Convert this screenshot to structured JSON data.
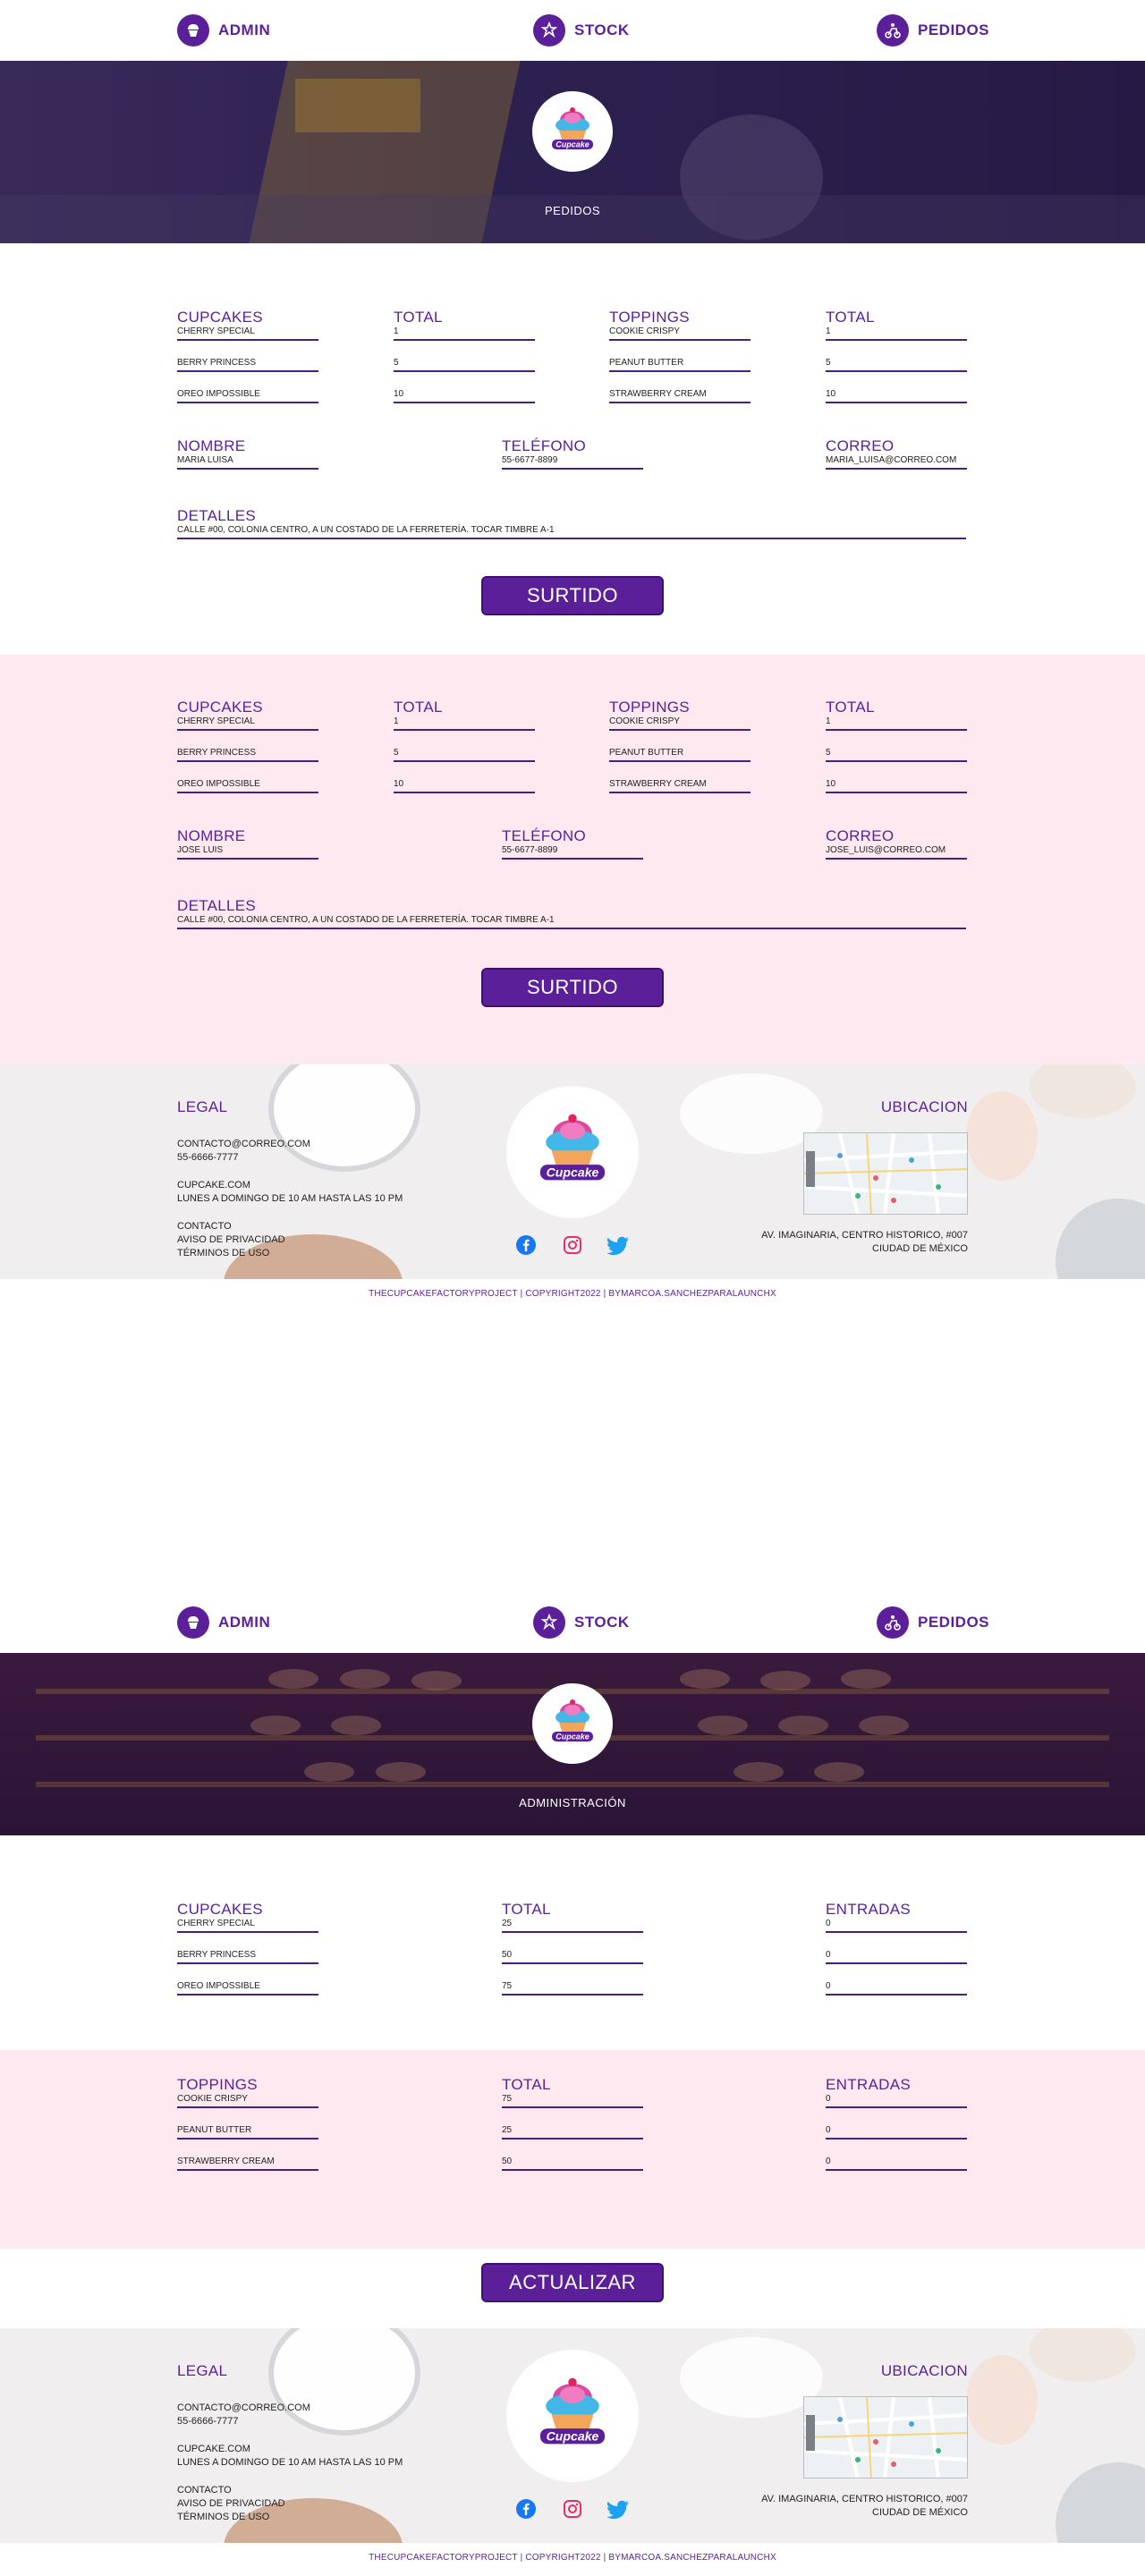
{
  "nav": {
    "admin_label": "ADMIN",
    "stock_label": "STOCK",
    "pedidos_label": "PEDIDOS"
  },
  "colors": {
    "accent": "#5b1f9a",
    "pink_band": "#fde9ef"
  },
  "logo": {
    "text": "Cupcake"
  },
  "pedidos_page": {
    "hero_title": "PEDIDOS",
    "orders": [
      {
        "cupcakes_label": "CUPCAKES",
        "total_label": "TOTAL",
        "toppings_label": "TOPPINGS",
        "total2_label": "TOTAL",
        "cupcakes": [
          "CHERRY SPECIAL",
          "BERRY PRINCESS",
          "OREO IMPOSSIBLE"
        ],
        "cupcake_totals": [
          "1",
          "5",
          "10"
        ],
        "toppings": [
          "COOKIE CRISPY",
          "PEANUT BUTTER",
          "STRAWBERRY CREAM"
        ],
        "topping_totals": [
          "1",
          "5",
          "10"
        ],
        "nombre_label": "NOMBRE",
        "nombre": "MARIA LUISA",
        "telefono_label": "TELÉFONO",
        "telefono": "55-6677-8899",
        "correo_label": "CORREO",
        "correo": "MARIA_LUISA@CORREO.COM",
        "detalles_label": "DETALLES",
        "detalles": "CALLE #00, COLONIA CENTRO, A UN COSTADO DE LA FERRETERÍA. TOCAR TIMBRE A-1",
        "button": "SURTIDO"
      },
      {
        "cupcakes_label": "CUPCAKES",
        "total_label": "TOTAL",
        "toppings_label": "TOPPINGS",
        "total2_label": "TOTAL",
        "cupcakes": [
          "CHERRY SPECIAL",
          "BERRY PRINCESS",
          "OREO IMPOSSIBLE"
        ],
        "cupcake_totals": [
          "1",
          "5",
          "10"
        ],
        "toppings": [
          "COOKIE CRISPY",
          "PEANUT BUTTER",
          "STRAWBERRY CREAM"
        ],
        "topping_totals": [
          "1",
          "5",
          "10"
        ],
        "nombre_label": "NOMBRE",
        "nombre": "JOSE LUIS",
        "telefono_label": "TELÉFONO",
        "telefono": "55-6677-8899",
        "correo_label": "CORREO",
        "correo": "JOSE_LUIS@CORREO.COM",
        "detalles_label": "DETALLES",
        "detalles": "CALLE #00, COLONIA CENTRO, A UN COSTADO DE LA FERRETERÍA. TOCAR TIMBRE A-1",
        "button": "SURTIDO"
      }
    ]
  },
  "admin_page": {
    "hero_title": "ADMINISTRACIÓN",
    "cupcakes_block": {
      "title": "CUPCAKES",
      "total_label": "TOTAL",
      "entradas_label": "ENTRADAS",
      "items": [
        "CHERRY SPECIAL",
        "BERRY PRINCESS",
        "OREO IMPOSSIBLE"
      ],
      "totals": [
        "25",
        "50",
        "75"
      ],
      "entradas": [
        "0",
        "0",
        "0"
      ]
    },
    "toppings_block": {
      "title": "TOPPINGS",
      "total_label": "TOTAL",
      "entradas_label": "ENTRADAS",
      "items": [
        "COOKIE CRISPY",
        "PEANUT BUTTER",
        "STRAWBERRY CREAM"
      ],
      "totals": [
        "75",
        "25",
        "50"
      ],
      "entradas": [
        "0",
        "0",
        "0"
      ]
    },
    "button": "ACTUALIZAR"
  },
  "footer": {
    "legal_title": "LEGAL",
    "email": "CONTACTO@CORREO.COM",
    "phone": "55-6666-7777",
    "site": "CUPCAKE.COM",
    "hours": "LUNES A DOMINGO DE 10 AM HASTA LAS 10 PM",
    "contacto": "CONTACTO",
    "privacidad": "AVISO DE PRIVACIDAD",
    "terminos": "TÉRMINOS DE USO",
    "ubicacion_title": "UBICACION",
    "address_line1": "AV. IMAGINARIA, CENTRO HISTORICO, #007",
    "address_line2": "CIUDAD DE MÉXICO",
    "copyright": "THECUPCAKEFACTORYPROJECT | COPYRIGHT2022 | BYMARCOA.SANCHEZPARALAUNCHX",
    "socials": [
      "facebook-icon",
      "instagram-icon",
      "twitter-icon"
    ]
  }
}
